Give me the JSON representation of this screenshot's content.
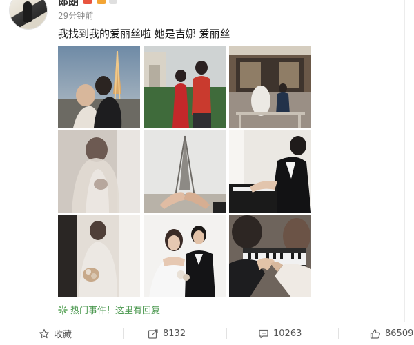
{
  "post": {
    "username": "郎朗",
    "timestamp": "29分钟前",
    "text": "我找到我的爱丽丝啦 她是吉娜 爱丽丝"
  },
  "photos": [
    {
      "subject": "couple-kissing-eiffel-night"
    },
    {
      "subject": "couple-red-qipao-arc-de-triomphe"
    },
    {
      "subject": "couple-at-paris-cafe"
    },
    {
      "subject": "bride-veil-portrait"
    },
    {
      "subject": "holding-hands-eiffel-tower"
    },
    {
      "subject": "groom-playing-piano"
    },
    {
      "subject": "couple-doorway-embrace"
    },
    {
      "subject": "couple-wedding-portrait"
    },
    {
      "subject": "hands-on-piano-keys"
    }
  ],
  "hot_topic": {
    "icon": "sparkle-icon",
    "text": "热门事件！这里有回复"
  },
  "actions": {
    "favorite": {
      "label": "收藏",
      "icon": "star-icon"
    },
    "repost": {
      "count": "8132",
      "icon": "repost-icon"
    },
    "comment": {
      "count": "10263",
      "icon": "comment-icon"
    },
    "like": {
      "count": "86509",
      "icon": "thumbs-up-icon"
    }
  },
  "colors": {
    "hot_topic": "#4e9a52",
    "muted": "#8a8a8a",
    "text": "#1a1a1a"
  }
}
